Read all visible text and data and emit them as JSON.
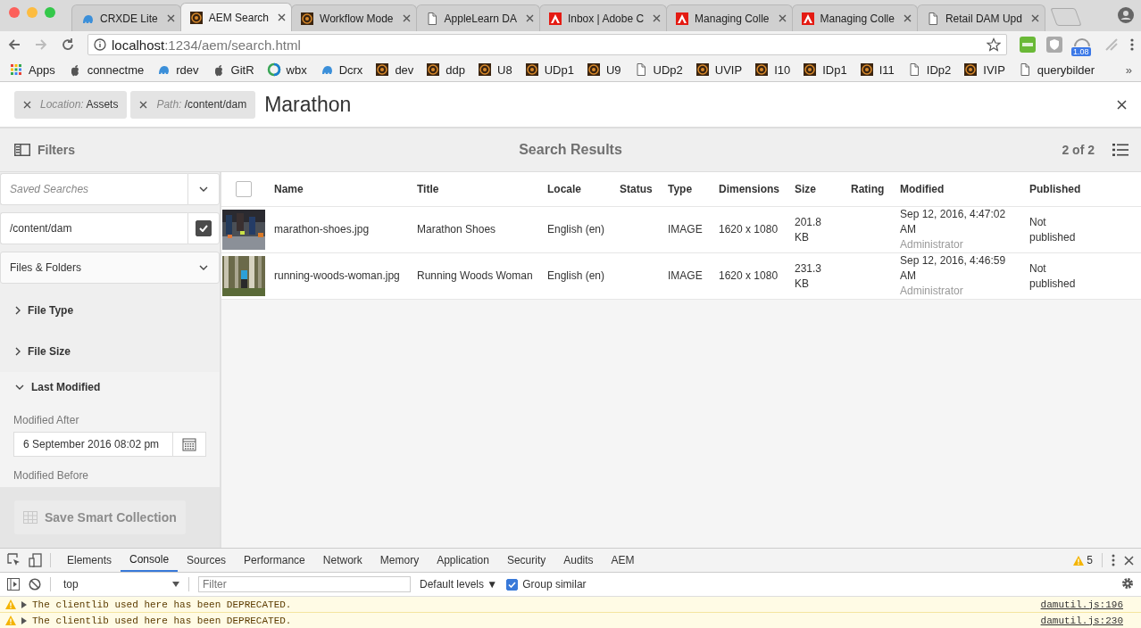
{
  "browser": {
    "tabs": [
      {
        "label": "CRXDE Lite",
        "selected": false
      },
      {
        "label": "AEM Search",
        "selected": true
      },
      {
        "label": "Workflow Mode",
        "selected": false
      },
      {
        "label": "AppleLearn DA",
        "selected": false
      },
      {
        "label": "Inbox | Adobe C",
        "selected": false
      },
      {
        "label": "Managing Colle",
        "selected": false
      },
      {
        "label": "Managing Colle",
        "selected": false
      },
      {
        "label": "Retail DAM Upd",
        "selected": false
      }
    ],
    "url": {
      "host": "localhost",
      "path": ":1234/aem/search.html"
    },
    "extension_badge": "1.08",
    "bookmarks": [
      {
        "label": "Apps"
      },
      {
        "label": "connectme"
      },
      {
        "label": "rdev"
      },
      {
        "label": "GitR"
      },
      {
        "label": "wbx"
      },
      {
        "label": "Dcrx"
      },
      {
        "label": "dev"
      },
      {
        "label": "ddp"
      },
      {
        "label": "U8"
      },
      {
        "label": "UDp1"
      },
      {
        "label": "U9"
      },
      {
        "label": "UDp2"
      },
      {
        "label": "UVIP"
      },
      {
        "label": "I10"
      },
      {
        "label": "IDp1"
      },
      {
        "label": "I11"
      },
      {
        "label": "IDp2"
      },
      {
        "label": "IVIP"
      },
      {
        "label": "querybilder"
      }
    ],
    "more": "»"
  },
  "search": {
    "tags": [
      {
        "key": "Location:",
        "value": "Assets"
      },
      {
        "key": "Path:",
        "value": "/content/dam"
      }
    ],
    "query": "Marathon"
  },
  "header": {
    "filters": "Filters",
    "title": "Search Results",
    "count": "2 of 2"
  },
  "sidebar": {
    "saved_searches": {
      "placeholder": "Saved Searches"
    },
    "path": {
      "value": "/content/dam",
      "checked": true
    },
    "scope": "Files & Folders",
    "sections": [
      {
        "label": "File Type",
        "expanded": false
      },
      {
        "label": "File Size",
        "expanded": false
      },
      {
        "label": "Last Modified",
        "expanded": true
      }
    ],
    "modified_after": {
      "label": "Modified After",
      "value": "6 September 2016 08:02 pm"
    },
    "modified_before": {
      "label": "Modified Before"
    },
    "save_button": {
      "label": "Save Smart Collection",
      "disabled": true
    }
  },
  "table": {
    "select_all": {
      "checked": false
    },
    "columns": [
      "Name",
      "Title",
      "Locale",
      "Status",
      "Type",
      "Dimensions",
      "Size",
      "Rating",
      "Modified",
      "Published"
    ],
    "rows": [
      {
        "name": "marathon-shoes.jpg",
        "title": "Marathon Shoes",
        "locale": "English (en)",
        "type": "IMAGE",
        "dimensions": "1620 x 1080",
        "size": "201.8 KB",
        "modified": "Sep 12, 2016, 4:47:02 AM",
        "modified_by": "Administrator",
        "published": "Not published"
      },
      {
        "name": "running-woods-woman.jpg",
        "title": "Running Woods Woman",
        "locale": "English (en)",
        "type": "IMAGE",
        "dimensions": "1620 x 1080",
        "size": "231.3 KB",
        "modified": "Sep 12, 2016, 4:46:59 AM",
        "modified_by": "Administrator",
        "published": "Not published"
      }
    ]
  },
  "devtools": {
    "tabs": [
      {
        "label": "Elements",
        "selected": false
      },
      {
        "label": "Console",
        "selected": true
      },
      {
        "label": "Sources",
        "selected": false
      },
      {
        "label": "Performance",
        "selected": false
      },
      {
        "label": "Network",
        "selected": false
      },
      {
        "label": "Memory",
        "selected": false
      },
      {
        "label": "Application",
        "selected": false
      },
      {
        "label": "Security",
        "selected": false
      },
      {
        "label": "Audits",
        "selected": false
      },
      {
        "label": "AEM",
        "selected": false
      }
    ],
    "warnings": "5",
    "context": "top",
    "filter": {
      "placeholder": "Filter"
    },
    "levels": "Default levels ▼",
    "group_similar": {
      "label": "Group similar",
      "checked": true
    },
    "messages": [
      {
        "text": "The clientlib used here has been DEPRECATED.",
        "source": "damutil.js:196"
      },
      {
        "text": "The clientlib used here has been DEPRECATED.",
        "source": "damutil.js:230"
      }
    ]
  }
}
